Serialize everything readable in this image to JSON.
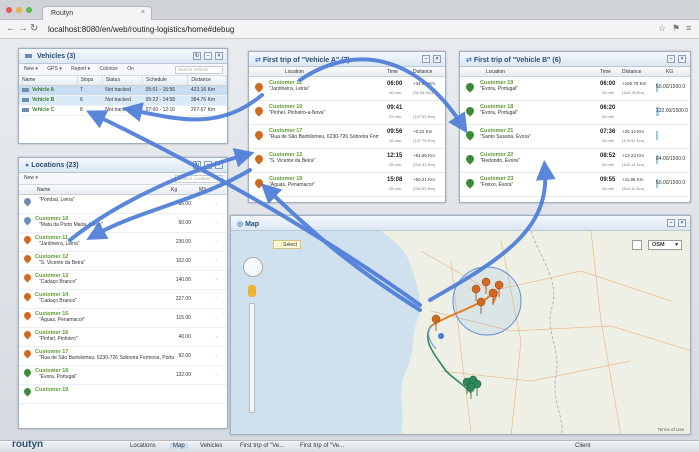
{
  "browser": {
    "tab_title": "Routyn",
    "url": "localhost:8080/en/web/routing-logistics/home#debug"
  },
  "vehicles_panel": {
    "title": "Vehicles (3)",
    "toolbar": [
      "New ▾",
      "GPS ▾",
      "Report ▾",
      "Colorize",
      "On"
    ],
    "search_placeholder": "Search Vehicle",
    "columns": [
      "Name",
      "Stops",
      "Status",
      "Schedule",
      "Distance"
    ],
    "rows": [
      {
        "name": "Vehicle A",
        "stops": "7",
        "status": "Not tracked",
        "schedule": "05:01 - 15:56",
        "distance": "423.16 Km",
        "extra": "04"
      },
      {
        "name": "Vehicle B",
        "stops": "6",
        "status": "Not tracked",
        "schedule": "05:22 - 14:58",
        "distance": "384.76 Km",
        "extra": "02"
      },
      {
        "name": "Vehicle C",
        "stops": "8",
        "status": "Not tracked",
        "schedule": "07:00 - 12:16",
        "distance": "207.67 Km",
        "extra": ""
      }
    ]
  },
  "locations_panel": {
    "title": "Locations (23)",
    "toolbar": [
      "New ▾"
    ],
    "search_placeholder": "Search Location",
    "columns": [
      "Name",
      "Kg",
      "M3"
    ],
    "rows": [
      {
        "name": "",
        "addr": "\"Pombal, Leiria\"",
        "kg": "86.00",
        "m3": "-",
        "color": "#6d8fb2"
      },
      {
        "name": "Customer 10",
        "addr": "\"Mata da Porto Maira, Leiria\"",
        "kg": "50.00",
        "m3": "-",
        "color": "#6d8fb2"
      },
      {
        "name": "Customer 11",
        "addr": "\"Jardineira, Leiria\"",
        "kg": "230.00",
        "m3": "-",
        "color": "#d2691e"
      },
      {
        "name": "Customer 12",
        "addr": "\"S. Vicente da Beira\"",
        "kg": "102.00",
        "m3": "-",
        "color": "#d2691e"
      },
      {
        "name": "Customer 13",
        "addr": "\"Cadaço Branco\"",
        "kg": "140.00",
        "m3": "-",
        "color": "#d2691e"
      },
      {
        "name": "Customer 14",
        "addr": "\"Cadaço Branco\"",
        "kg": "227.00",
        "m3": "-",
        "color": "#d2691e"
      },
      {
        "name": "Customer 15",
        "addr": "\"Águas, Penamacor\"",
        "kg": "115.00",
        "m3": "-",
        "color": "#d2691e"
      },
      {
        "name": "Customer 16",
        "addr": "\"Pinhel, Pinheiro\"",
        "kg": "40.00",
        "m3": "-",
        "color": "#d2691e"
      },
      {
        "name": "Customer 17",
        "addr": "\"Rua de São Bartolomeu, 6230-726 Sobreira Formosa, Portu",
        "kg": "92.00",
        "m3": "-",
        "color": "#d2691e"
      },
      {
        "name": "Customer 18",
        "addr": "\"Évora, Portugal\"",
        "kg": "132.00",
        "m3": "-",
        "color": "#3a8a3a"
      },
      {
        "name": "Customer 19",
        "addr": "",
        "kg": "",
        "m3": "",
        "color": "#3a8a3a"
      }
    ]
  },
  "trip_a": {
    "title": "First trip of \"Vehicle A\" (7)",
    "columns": [
      "Location",
      "Time",
      "Distance"
    ],
    "rows": [
      {
        "name": "Customer 11",
        "addr": "\"Jardineira, Leiria\"",
        "time": "06:00",
        "dur": "40 min",
        "dist": "+34.94 Km",
        "dist2": "(34.94 Km)"
      },
      {
        "name": "Customer 16",
        "addr": "\"Pinhel, Pinheiro-a-Nova\"",
        "time": "09:41",
        "dur": "29 min",
        "dist": "",
        "dist2": "(147.52 Km)"
      },
      {
        "name": "Customer 17",
        "addr": "\"Rua de São Bartolomeu, 6230-726 Sobreira Formosa, Portugal\"",
        "time": "09:56",
        "dur": "26 min",
        "dist": "+0.22 Km",
        "dist2": "(147.75 Km)"
      },
      {
        "name": "Customer 12",
        "addr": "\"S. Vicente da Beira\"",
        "time": "12:15",
        "dur": "35 min",
        "dist": "+54.66 Km",
        "dist2": "(202.41 Km)"
      },
      {
        "name": "Customer 15",
        "addr": "\"Águas, Penamacor\"",
        "time": "15:08",
        "dur": "35 min",
        "dist": "+50.21 Km",
        "dist2": "(252.62 Km)"
      }
    ]
  },
  "trip_b": {
    "title": "First trip of \"Vehicle B\" (6)",
    "columns": [
      "Location",
      "Time",
      "Distance",
      "KG"
    ],
    "rows": [
      {
        "name": "Customer 19",
        "addr": "\"Évora, Portugal\"",
        "time": "06:00",
        "dur": "20 min",
        "dist": "+150.78 Km",
        "dist2": "(150.78 Km)",
        "kg": "50.00/1500.0",
        "fill": 0.03
      },
      {
        "name": "Customer 18",
        "addr": "\"Évora, Portugal\"",
        "time": "06:20",
        "dur": "40 min",
        "dist": "",
        "dist2": "",
        "kg": "132.00/1500.0",
        "fill": 0.09
      },
      {
        "name": "Customer 21",
        "addr": "\"Santo Susana, Évora\"",
        "time": "07:36",
        "dur": "30 min",
        "dist": "+26.12 Km",
        "dist2": "(178.91 Km)",
        "kg": "",
        "fill": 0.0
      },
      {
        "name": "Customer 22",
        "addr": "\"Redondo, Évora\"",
        "time": "08:52",
        "dur": "40 min",
        "dist": "+13.23 Km",
        "dist2": "(192.14 Km)",
        "kg": "84.00/1500.0",
        "fill": 0.06
      },
      {
        "name": "Customer 23",
        "addr": "\"Freixo, Évora\"",
        "time": "09:55",
        "dur": "30 min",
        "dist": "+11.86 Km",
        "dist2": "(204.10 Km)",
        "kg": "50.00/1500.0",
        "fill": 0.03
      }
    ]
  },
  "map_panel": {
    "title": "Map",
    "select_label": "Select",
    "layer": "OSM",
    "attribution": "Terms of Use"
  },
  "taskbar": {
    "logo": "routyn",
    "items": [
      "Locations",
      "Map",
      "Vehicles",
      "First trip of \"Ve...",
      "First trip of \"Ve..."
    ],
    "right": "Client"
  },
  "colors": {
    "accent": "#4a7bd8",
    "route_orange": "#e67e22",
    "route_green": "#2e8b57"
  }
}
